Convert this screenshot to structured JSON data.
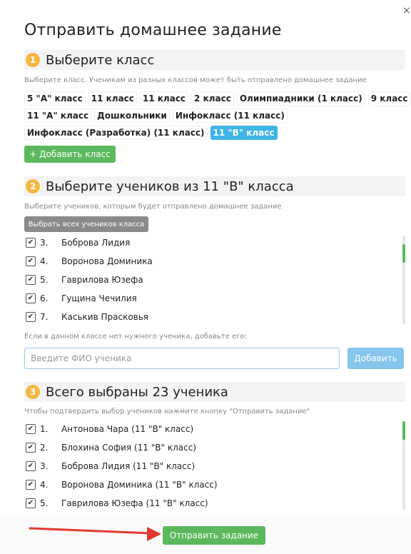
{
  "dialog": {
    "title": "Отправить домашнее задание",
    "close_label": "×"
  },
  "step1": {
    "number": "1",
    "title": "Выберите класс",
    "hint": "Выберите класс. Ученикам из разных классов может быть отправлено домашнее задание",
    "classes": [
      "5 \"А\" класс",
      "11 класс",
      "11 класс",
      "2 класс",
      "Олимпиадники (1 класс)",
      "9 класс",
      "11 \"А\" класс",
      "Дошкольники",
      "Инфокласс (11 класс)",
      "Инфокласс (Разработка) (11 класс)",
      "11 \"В\" класс"
    ],
    "selected_class": "11 \"В\" класс",
    "add_button": "+ Добавить класс"
  },
  "step2": {
    "number": "2",
    "title": "Выберите учеников из 11 \"В\" класса",
    "hint": "Выберите учеников, которым будет отправлено домашнее задание",
    "select_all": "Выбрать всех учеников класса",
    "students": [
      {
        "num": "3.",
        "name": "Боброва Лидия"
      },
      {
        "num": "4.",
        "name": "Воронова Доминика"
      },
      {
        "num": "5.",
        "name": "Гаврилова Юзефа"
      },
      {
        "num": "6.",
        "name": "Гущина Чечилия"
      },
      {
        "num": "7.",
        "name": "Каськив Прасковья"
      }
    ],
    "add_hint": "Если в данном классе нет нужного ученика, добавьте его:",
    "input_placeholder": "Введите ФИО ученика",
    "add_button": "Добавить"
  },
  "step3": {
    "number": "3",
    "title": "Всего выбраны 23 ученика",
    "hint": "Чтобы подтвердить выбор учеников нажмите кнопку \"Отправить задание\"",
    "selected": [
      {
        "num": "1.",
        "name": "Антонова Чара (11 \"В\" класс)"
      },
      {
        "num": "2.",
        "name": "Блохина София (11 \"В\" класс)"
      },
      {
        "num": "3.",
        "name": "Боброва Лидия (11 \"В\" класс)"
      },
      {
        "num": "4.",
        "name": "Воронова Доминика (11 \"В\" класс)"
      },
      {
        "num": "5.",
        "name": "Гаврилова Юзефа (11 \"В\" класс)"
      }
    ]
  },
  "footer": {
    "submit_button": "Отправить задание"
  },
  "colors": {
    "step_badge": "#f5b740",
    "green": "#5cb85c",
    "active_chip": "#3db5e6",
    "arrow": "#e03a2f"
  },
  "check_glyph": "✔"
}
